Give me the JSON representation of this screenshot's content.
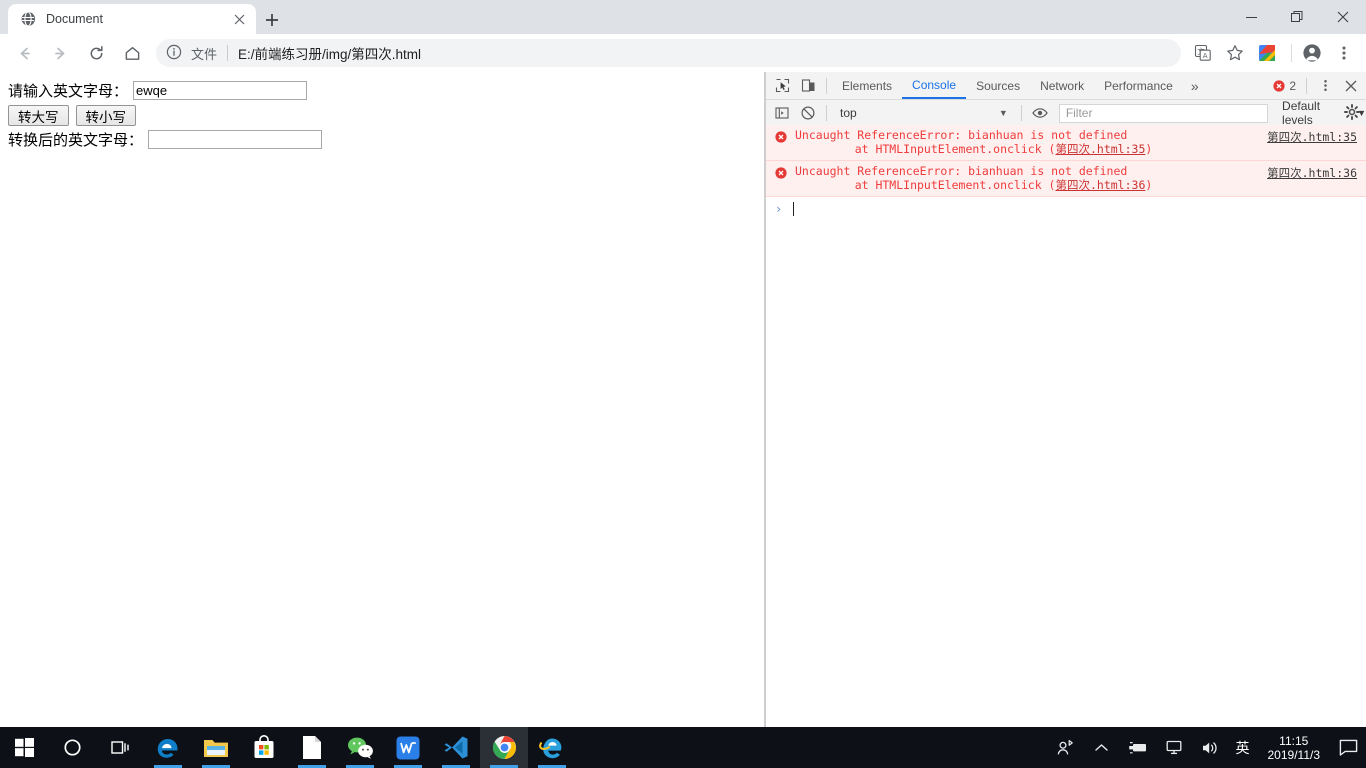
{
  "browser": {
    "tab": {
      "title": "Document",
      "favicon": "globe-icon",
      "close_icon": "close-icon"
    },
    "new_tab_label": "+",
    "window_controls": {
      "minimize": "minimize-icon",
      "maximize": "maximize-icon",
      "close": "close-icon"
    },
    "nav": {
      "back": "back-arrow-icon",
      "forward": "forward-arrow-icon",
      "reload": "reload-icon",
      "home": "home-icon"
    },
    "omnibox": {
      "info_icon": "info-circle-icon",
      "scheme_label": "文件",
      "url": "E:/前端练习册/img/第四次.html"
    },
    "actions": {
      "translate": "translate-icon",
      "bookmark": "star-icon",
      "extension": "extension-icon",
      "profile": "account-avatar-icon",
      "menu": "three-dot-menu-icon"
    }
  },
  "page": {
    "input_label": "请输入英文字母：",
    "input_value": "ewqe",
    "buttons": [
      {
        "label": "转大写"
      },
      {
        "label": "转小写"
      }
    ],
    "output_label": "转换后的英文字母：",
    "output_value": ""
  },
  "devtools": {
    "left_icons": [
      {
        "name": "inspect-element-icon"
      },
      {
        "name": "device-toolbar-icon"
      }
    ],
    "tabs": [
      {
        "label": "Elements",
        "active": false
      },
      {
        "label": "Console",
        "active": true
      },
      {
        "label": "Sources",
        "active": false
      },
      {
        "label": "Network",
        "active": false
      },
      {
        "label": "Performance",
        "active": false
      }
    ],
    "more_tabs_label": "»",
    "error_count": "2",
    "kebab_icon": "three-dot-menu-icon",
    "close_icon": "close-icon",
    "toolbar": {
      "sidebar_icon": "console-sidebar-icon",
      "clear_icon": "clear-console-icon",
      "context": "top",
      "eye_icon": "live-expression-eye-icon",
      "filter_placeholder": "Filter",
      "levels_label": "Default levels",
      "settings_icon": "gear-icon"
    },
    "messages": [
      {
        "level": "error",
        "text": "Uncaught ReferenceError: bianhuan is not defined",
        "stack_prefix": "    at HTMLInputElement.onclick (",
        "stack_link": "第四次.html:35",
        "stack_suffix": ")",
        "source": "第四次.html:35"
      },
      {
        "level": "error",
        "text": "Uncaught ReferenceError: bianhuan is not defined",
        "stack_prefix": "    at HTMLInputElement.onclick (",
        "stack_link": "第四次.html:36",
        "stack_suffix": ")",
        "source": "第四次.html:36"
      }
    ],
    "prompt_chevron": "›"
  },
  "taskbar": {
    "items": [
      {
        "name": "start-button-icon",
        "active": false,
        "running": false
      },
      {
        "name": "cortana-search-icon",
        "active": false,
        "running": false
      },
      {
        "name": "task-view-icon",
        "active": false,
        "running": false
      },
      {
        "name": "microsoft-edge-icon",
        "active": false,
        "running": true
      },
      {
        "name": "file-explorer-icon",
        "active": false,
        "running": true
      },
      {
        "name": "microsoft-store-icon",
        "active": false,
        "running": false
      },
      {
        "name": "notepad-document-icon",
        "active": false,
        "running": true
      },
      {
        "name": "wechat-icon",
        "active": false,
        "running": true
      },
      {
        "name": "wps-office-icon",
        "active": false,
        "running": true
      },
      {
        "name": "visual-studio-code-icon",
        "active": false,
        "running": true
      },
      {
        "name": "google-chrome-icon",
        "active": true,
        "running": true
      },
      {
        "name": "internet-explorer-icon",
        "active": false,
        "running": true
      }
    ],
    "tray": {
      "people_icon": "people-icon",
      "chevron_icon": "show-hidden-icons-chevron",
      "usb_icon": "usb-device-icon",
      "network_icon": "network-icon",
      "volume_icon": "volume-icon",
      "ime_label": "英",
      "time": "11:15",
      "date": "2019/11/3",
      "notifications_icon": "action-center-icon"
    }
  },
  "colors": {
    "chrome_bg": "#dee1e6",
    "accent_blue": "#1a73e8",
    "error_red": "#ef3c3c",
    "error_bg": "#fff0f0",
    "taskbar_bg": "#0d1117"
  }
}
